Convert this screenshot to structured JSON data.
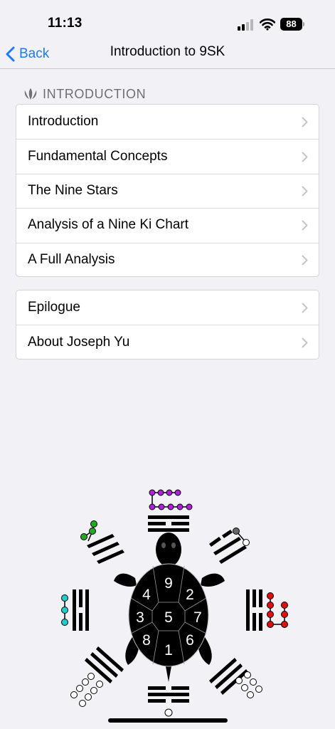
{
  "status_bar": {
    "time": "11:13",
    "battery": "88"
  },
  "nav": {
    "back_label": "Back",
    "title": "Introduction to 9SK"
  },
  "section": {
    "header": "INTRODUCTION"
  },
  "group1": [
    {
      "label": "Introduction"
    },
    {
      "label": "Fundamental Concepts"
    },
    {
      "label": "The Nine Stars"
    },
    {
      "label": "Analysis of a Nine Ki Chart"
    },
    {
      "label": "A Full Analysis"
    }
  ],
  "group2": [
    {
      "label": "Epilogue"
    },
    {
      "label": "About Joseph Yu"
    }
  ],
  "emblem": {
    "shell_numbers": {
      "top": "9",
      "top_right": "2",
      "right": "7",
      "bottom_right": "6",
      "bottom": "1",
      "bottom_left": "8",
      "left": "3",
      "top_left": "4",
      "center": "5"
    },
    "colors": {
      "purple": "#b020d8",
      "green": "#22aa22",
      "gray": "#666666",
      "cyan": "#22cccc",
      "red": "#dd1111",
      "white": "#ffffff"
    }
  },
  "icons": [
    "cellular-signal-icon",
    "wifi-icon",
    "chevron-left-icon",
    "section-logo-icon",
    "chevron-right-icon"
  ]
}
